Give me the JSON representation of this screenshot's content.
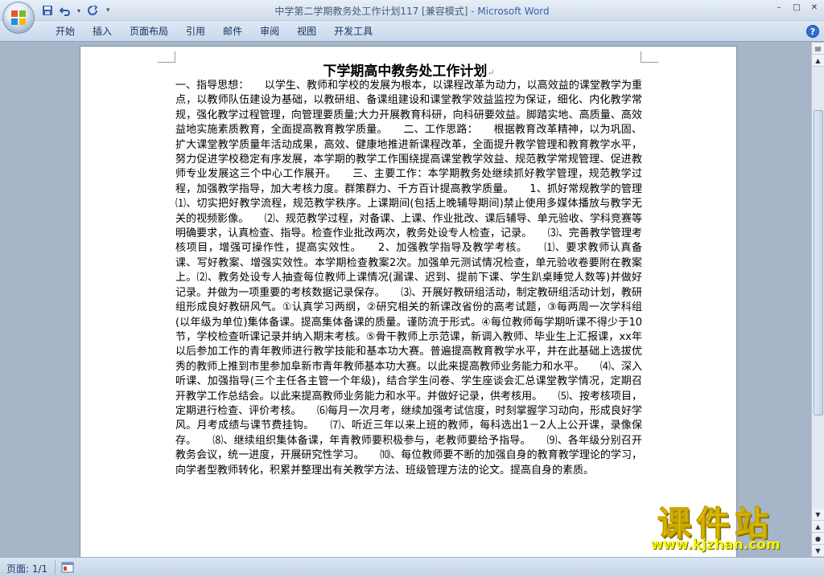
{
  "window": {
    "title_doc": "中学第二学期教务处工作计划117 [兼容模式] - ",
    "title_app": "Microsoft Word",
    "controls": [
      "–",
      "□",
      "✕"
    ]
  },
  "quick_access": {
    "save_icon": "save-icon",
    "undo_icon": "undo-icon",
    "redo_icon": "redo-icon",
    "customize": "▾"
  },
  "ribbon": {
    "tabs": [
      "开始",
      "插入",
      "页面布局",
      "引用",
      "邮件",
      "审阅",
      "视图",
      "开发工具"
    ],
    "help": "?"
  },
  "document": {
    "title": "下学期高中教务处工作计划",
    "paragraph_mark": "↵",
    "body": "一、指导思想：　　以学生、教师和学校的发展为根本，以课程改革为动力，以高效益的课堂教学为重点，以教师队伍建设为基础，以教研组、备课组建设和课堂教学效益监控为保证，细化、内化教学常规，强化教学过程管理，向管理要质量;大力开展教育科研，向科研要效益。脚踏实地、高质量、高效益地实施素质教育，全面提高教育教学质量。　　二、工作思路：　　根据教育改革精神，以为巩固、扩大课堂教学质量年活动成果，高效、健康地推进新课程改革，全面提升教学管理和教育教学水平，努力促进学校稳定有序发展，本学期的教学工作围绕提高课堂教学效益、规范教学常规管理、促进教师专业发展这三个中心工作展开。　　三、主要工作：本学期教务处继续抓好教学管理，规范教学过程，加强教学指导，加大考核力度。群策群力、千方百计提高教学质量。　　1、抓好常规教学的管理　　⑴、切实把好教学流程，规范教学秩序。上课期间(包括上晚辅导期间)禁止使用多媒体播放与教学无关的视频影像。　　⑵、规范教学过程，对备课、上课、作业批改、课后辅导、单元验收、学科竞赛等明确要求，认真检查、指导。检查作业批改两次，教务处设专人检查，记录。　　⑶、完善教学管理考核项目，增强可操作性，提高实效性。　　2、加强教学指导及教学考核。　　⑴、要求教师认真备课、写好教案、增强实效性。本学期检查教案2次。加强单元测试情况检查，单元验收卷要附在教案上。⑵、教务处设专人抽查每位教师上课情况(漏课、迟到、提前下课、学生趴桌睡觉人数等)并做好记录。并做为一项重要的考核数据记录保存。　　⑶、开展好教研组活动，制定教研组活动计划，教研组形成良好教研风气。①认真学习两纲，②研究相关的新课改省份的高考试题，③每两周一次学科组(以年级为单位)集体备课。提高集体备课的质量。谨防流于形式。④每位教师每学期听课不得少于10节，学校检查听课记录并纳入期末考核。⑤骨干教师上示范课，新调入教师、毕业生上汇报课，xx年以后参加工作的青年教师进行教学技能和基本功大赛。普遍提高教育教学水平，并在此基础上选拔优秀的教师上推到市里参加阜新市青年教师基本功大赛。以此来提高教师业务能力和水平。　　⑷、深入听课、加强指导(三个主任各主管一个年级)，结合学生问卷、学生座谈会汇总课堂教学情况，定期召开教学工作总结会。以此来提高教师业务能力和水平。并做好记录，供考核用。　　⑸、按考核项目，定期进行检查、评价考核。　　⑹每月一次月考，继续加强考试信度，时刻掌握学习动向，形成良好学风。月考成绩与课节费挂钩。　　⑺、听近三年以来上班的教师，每科选出1－2人上公开课，录像保存。　　⑻、继续组织集体备课，年青教师要积极参与，老教师要给予指导。　　⑼、各年级分别召开教务会议，统一进度，开展研究性学习。　　⑽、每位教师要不断的加强自身的教育教学理论的学习，向学者型教师转化，积累并整理出有关教学方法、班级管理方法的论文。提高自身的素质。"
  },
  "status": {
    "page": "页面: 1/1"
  },
  "watermark": {
    "title": "课件站",
    "url": "www.kjzhan.com"
  },
  "colors": {
    "frame": "#c9d8ec",
    "workspace": "#a7b5c9",
    "app_title": "#3b5ea8",
    "watermark": "#f4f400"
  }
}
